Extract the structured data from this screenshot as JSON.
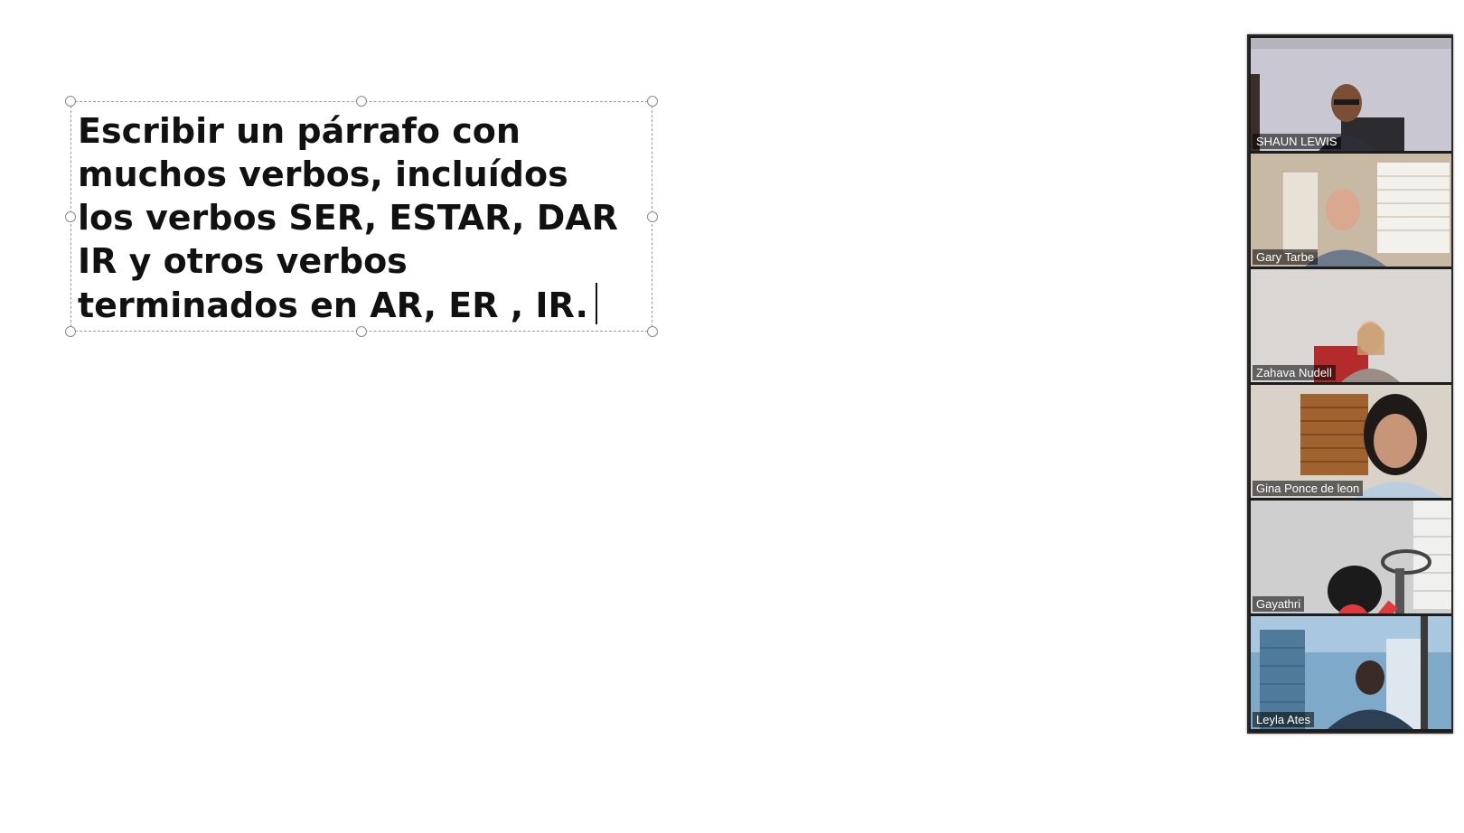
{
  "slide": {
    "text_lines": [
      "Escribir un párrafo con",
      "muchos verbos, incluídos",
      "los verbos SER, ESTAR, DAR",
      "IR y otros verbos",
      "terminados en AR, ER , IR."
    ]
  },
  "participants": [
    {
      "name": "SHAUN LEWIS",
      "muted": false,
      "active": false
    },
    {
      "name": "Gary Tarbe",
      "muted": false,
      "active": false
    },
    {
      "name": "Zahava Nudell",
      "muted": false,
      "active": false
    },
    {
      "name": "Gina Ponce de leon",
      "muted": false,
      "active": true
    },
    {
      "name": "Gayathri",
      "muted": true,
      "active": false,
      "mute_icon": "microphone-muted-icon"
    },
    {
      "name": "Leyla Ates",
      "muted": false,
      "active": false
    }
  ],
  "colors": {
    "active_speaker_border": "#7dd13a",
    "mute_icon": "#e0393e"
  }
}
